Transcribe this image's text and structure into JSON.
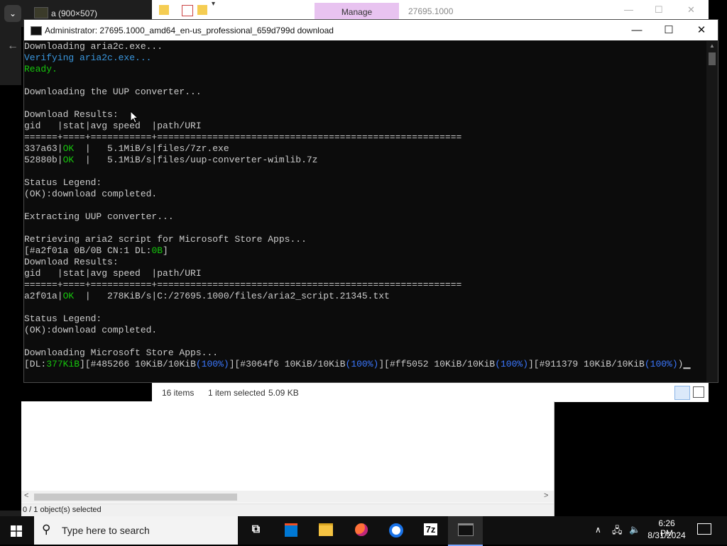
{
  "browser": {
    "tab_title": "a (900×507)",
    "tabs_button": "⌄",
    "back": "←"
  },
  "explorer": {
    "ribbon_tab": "Manage",
    "path": "27695.1000",
    "status_items": "16 items",
    "status_selected": "1 item selected",
    "status_size": "5.09 KB"
  },
  "sevenzip": {
    "status_text": "0 / 1 object(s) selected"
  },
  "cmd": {
    "title": "Administrator:  27695.1000_amd64_en-us_professional_659d799d download",
    "minimize": "—",
    "maximize": "☐",
    "close": "✕",
    "colors": {
      "default": "#cccccc",
      "green": "#16c60c",
      "cyan": "#3a96dd",
      "blue": "#3b78ff"
    },
    "lines": [
      [
        {
          "t": "Downloading aria2c.exe..."
        }
      ],
      [
        {
          "t": "Verifying aria2c.exe...",
          "c": "cyan"
        }
      ],
      [
        {
          "t": "Ready.",
          "c": "green"
        }
      ],
      [],
      [
        {
          "t": "Downloading the UUP converter..."
        }
      ],
      [],
      [
        {
          "t": "Download Results:"
        }
      ],
      [
        {
          "t": "gid   |stat|avg speed  |path/URI"
        }
      ],
      [
        {
          "t": "======+====+===========+======================================================="
        }
      ],
      [
        {
          "t": "337a63|"
        },
        {
          "t": "OK",
          "c": "green"
        },
        {
          "t": "  |   5.1MiB/s|files/7zr.exe"
        }
      ],
      [
        {
          "t": "52880b|"
        },
        {
          "t": "OK",
          "c": "green"
        },
        {
          "t": "  |   5.1MiB/s|files/uup-converter-wimlib.7z"
        }
      ],
      [],
      [
        {
          "t": "Status Legend:"
        }
      ],
      [
        {
          "t": "(OK):download completed."
        }
      ],
      [],
      [
        {
          "t": "Extracting UUP converter..."
        }
      ],
      [],
      [
        {
          "t": "Retrieving aria2 script for Microsoft Store Apps..."
        }
      ],
      [
        {
          "t": "[#a2f01a 0B/0B CN:1 DL:"
        },
        {
          "t": "0B",
          "c": "green"
        },
        {
          "t": "]"
        }
      ],
      [
        {
          "t": "Download Results:"
        }
      ],
      [
        {
          "t": "gid   |stat|avg speed  |path/URI"
        }
      ],
      [
        {
          "t": "======+====+===========+======================================================="
        }
      ],
      [
        {
          "t": "a2f01a|"
        },
        {
          "t": "OK",
          "c": "green"
        },
        {
          "t": "  |   278KiB/s|C:/27695.1000/files/aria2_script.21345.txt"
        }
      ],
      [],
      [
        {
          "t": "Status Legend:"
        }
      ],
      [
        {
          "t": "(OK):download completed."
        }
      ],
      [],
      [
        {
          "t": "Downloading Microsoft Store Apps..."
        }
      ],
      [
        {
          "t": "[DL:"
        },
        {
          "t": "377KiB",
          "c": "green"
        },
        {
          "t": "]["
        },
        {
          "t": "#485266 10KiB/10KiB"
        },
        {
          "t": "(100%)",
          "c": "blue"
        },
        {
          "t": "]["
        },
        {
          "t": "#3064f6 10KiB/10KiB"
        },
        {
          "t": "(100%)",
          "c": "blue"
        },
        {
          "t": "]["
        },
        {
          "t": "#ff5052 10KiB/10KiB"
        },
        {
          "t": "(100%)",
          "c": "blue"
        },
        {
          "t": "]["
        },
        {
          "t": "#911379 10KiB/10KiB"
        },
        {
          "t": "(100%)",
          "c": "blue"
        },
        {
          "t": ")▁"
        }
      ]
    ]
  },
  "taskbar": {
    "search_placeholder": "Type here to search",
    "time": "6:26 PM",
    "date": "8/31/2024",
    "sevenzip_label": "7z",
    "tray_up": "∧"
  }
}
